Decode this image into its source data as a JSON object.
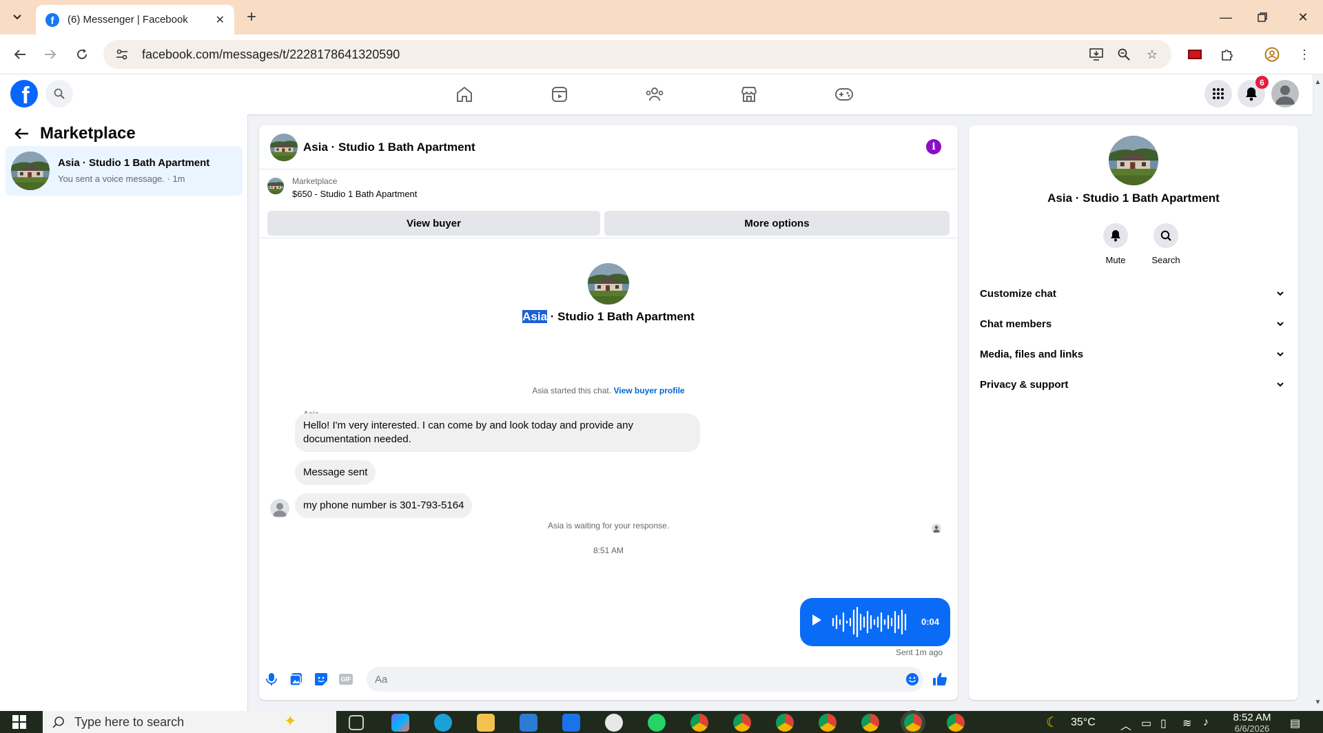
{
  "browser": {
    "tab_title": "(6) Messenger | Facebook",
    "tab_favicon": "f",
    "url": "facebook.com/messages/t/2228178641320590"
  },
  "fb": {
    "logo": "f",
    "notification_count": "6",
    "brand_color": "#0866ff"
  },
  "left": {
    "title": "Marketplace",
    "conversation": {
      "name": "Asia · Studio 1 Bath Apartment",
      "preview": "You sent a voice message. · 1m"
    }
  },
  "chat": {
    "header_name": "Asia · Studio 1 Bath Apartment",
    "listing_category": "Marketplace",
    "listing_price_title": "$650 - Studio 1 Bath Apartment",
    "view_buyer_label": "View buyer",
    "more_options_label": "More options",
    "intro_name_highlight": "Asia",
    "intro_name_rest": " · Studio 1 Bath Apartment",
    "started_note": "Asia started this chat.",
    "view_buyer_profile_link": "View buyer profile",
    "sender_name": "Asia",
    "messages": [
      {
        "text": "Hello! I'm very interested. I can come by and look today and provide any documentation needed."
      },
      {
        "text": "Message sent"
      },
      {
        "text": "my phone number is 301-793-5164"
      }
    ],
    "waiting_note": "Asia is waiting for your response.",
    "timestamp": "8:51 AM",
    "voice_duration": "0:04",
    "sent_time": "Sent 1m ago",
    "composer_placeholder": "Aa"
  },
  "right": {
    "name": "Asia · Studio 1 Bath Apartment",
    "actions": [
      {
        "label": "Mute",
        "icon": "bell-icon"
      },
      {
        "label": "Search",
        "icon": "search-icon"
      }
    ],
    "sections": [
      {
        "label": "Customize chat"
      },
      {
        "label": "Chat members"
      },
      {
        "label": "Media, files and links"
      },
      {
        "label": "Privacy & support"
      }
    ]
  },
  "taskbar": {
    "search_placeholder": "Type here to search",
    "temperature": "35°C",
    "time": "8:52 AM",
    "date": "6/6/2026"
  }
}
